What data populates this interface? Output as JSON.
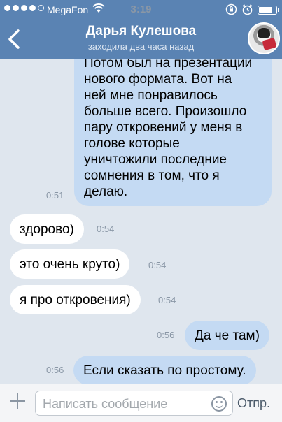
{
  "status_bar": {
    "carrier": "MegaFon",
    "time": "3:19",
    "battery_level": 0.85
  },
  "header": {
    "title": "Дарья Кулешова",
    "subtitle": "заходила два часа назад"
  },
  "messages": [
    {
      "direction": "out",
      "lines": [
        "Потом был на презентации",
        "нового формата. Вот на",
        "ней мне понравилось",
        "больше всего. Произошло",
        "пару откровений у меня в",
        "голове которые",
        "уничтожили последние",
        "сомнения в том, что я",
        "делаю."
      ],
      "time": "0:51"
    },
    {
      "direction": "in",
      "text": "здорово)",
      "time": "0:54"
    },
    {
      "direction": "in",
      "text": "это очень круто)",
      "time": "0:54"
    },
    {
      "direction": "in",
      "text": "я про откровения)",
      "time": "0:54"
    },
    {
      "direction": "out",
      "text": "Да че там)",
      "time": "0:56"
    },
    {
      "direction": "out",
      "text": "Если сказать по простому.",
      "time": "0:56"
    }
  ],
  "composer": {
    "placeholder": "Написать сообщение",
    "send_label": "Отпр."
  }
}
